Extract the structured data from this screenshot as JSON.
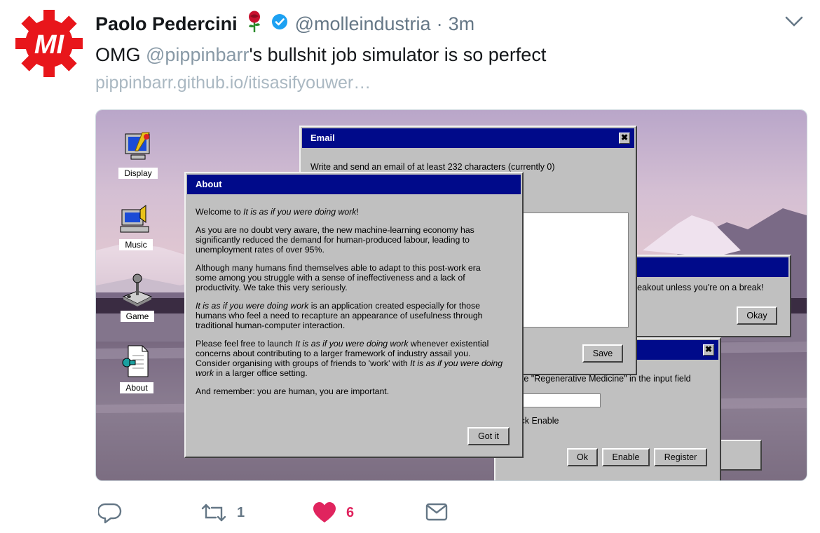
{
  "tweet": {
    "author_name": "Paolo Pedercini",
    "author_handle": "@molleindustria",
    "dot": "·",
    "time": "3m",
    "text_prefix": "OMG ",
    "mention": "@pippinbarr",
    "text_suffix": "'s bullshit job simulator is so perfect",
    "link": "pippinbarr.github.io/itisasifyouwer…",
    "avatar_logo": "MI",
    "icons": {
      "rose": "rose-icon",
      "verified": "verified-badge-icon",
      "menu": "chevron-down-icon"
    },
    "colors": {
      "avatar": "#e8161b",
      "verified": "#1da1f2",
      "like": "#e0245e",
      "link": "#aab8c2"
    }
  },
  "actions": {
    "reply_icon": "reply-icon",
    "retweet_icon": "retweet-icon",
    "retweet_count": "1",
    "like_icon": "heart-icon",
    "like_count": "6",
    "dm_icon": "mail-icon"
  },
  "desktop": {
    "icons": [
      {
        "label": "Display",
        "icon": "display-icon"
      },
      {
        "label": "Music",
        "icon": "music-icon"
      },
      {
        "label": "Game",
        "icon": "joystick-icon"
      },
      {
        "label": "About",
        "icon": "document-icon"
      }
    ],
    "email": {
      "title": "Email",
      "close": "✖",
      "instruction": "Write and send an email of at least 232 characters (currently 0)",
      "save": "Save"
    },
    "breakout": {
      "text": "reakout unless you're on a break!",
      "okay": "Okay"
    },
    "register": {
      "close": "✖",
      "instruction": "rite \"Regenerative Medicine\" in the input field",
      "instruction2": "lick Enable",
      "ok": "Ok",
      "enable": "Enable",
      "register": "Register"
    },
    "about": {
      "title": "About",
      "p1_prefix": "Welcome to ",
      "p1_em": "It is as if you were doing work",
      "p1_suffix": "!",
      "p2": "As you are no doubt very aware, the new machine-learning economy has significantly reduced the demand for human-produced labour, leading to unemployment rates of over 95%.",
      "p3": "Although many humans find themselves able to adapt to this post-work era some among you struggle with a sense of ineffectiveness and a lack of productivity. We take this very seriously.",
      "p4_em": "It is as if you were doing work",
      "p4_suffix": " is an application created especially for those humans who feel a need to recapture an appearance of usefulness through traditional human-computer interaction.",
      "p5_a": "Please feel free to launch ",
      "p5_em1": "It is as if you were doing work",
      "p5_b": " whenever existential concerns about contributing to a larger framework of industry assail you. Consider organising with groups of friends to 'work' with ",
      "p5_em2": "It is as if you were doing work",
      "p5_c": " in a larger office setting.",
      "p6": "And remember: you are human, you are important.",
      "got_it": "Got it"
    },
    "colors": {
      "titlebar": "#000a8a",
      "window": "#c0c0c0"
    }
  }
}
